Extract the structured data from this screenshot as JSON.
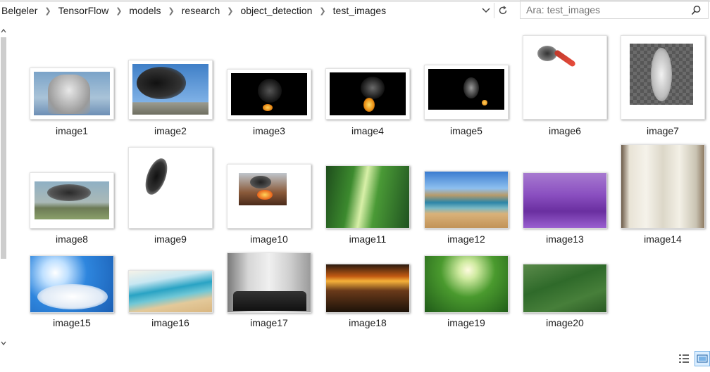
{
  "breadcrumb": [
    "Belgeler",
    "TensorFlow",
    "models",
    "research",
    "object_detection",
    "test_images"
  ],
  "search": {
    "placeholder": "Ara: test_images"
  },
  "files": [
    {
      "name": "image1",
      "icon": "smoke-stacks-image"
    },
    {
      "name": "image2",
      "icon": "black-smoke-image"
    },
    {
      "name": "image3",
      "icon": "smoke-fire-dark-image"
    },
    {
      "name": "image4",
      "icon": "smoke-fire-dark-image"
    },
    {
      "name": "image5",
      "icon": "smoke-fire-dark-image"
    },
    {
      "name": "image6",
      "icon": "smoke-red-image"
    },
    {
      "name": "image7",
      "icon": "white-smoke-image"
    },
    {
      "name": "image8",
      "icon": "smoke-landscape-image"
    },
    {
      "name": "image9",
      "icon": "black-smoke-image"
    },
    {
      "name": "image10",
      "icon": "fire-building-image"
    },
    {
      "name": "image11",
      "icon": "forest-image"
    },
    {
      "name": "image12",
      "icon": "beach-image"
    },
    {
      "name": "image13",
      "icon": "lavender-field-image"
    },
    {
      "name": "image14",
      "icon": "curtain-window-image"
    },
    {
      "name": "image15",
      "icon": "sky-clouds-image"
    },
    {
      "name": "image16",
      "icon": "beach-image"
    },
    {
      "name": "image17",
      "icon": "living-room-image"
    },
    {
      "name": "image18",
      "icon": "sunset-sea-image"
    },
    {
      "name": "image19",
      "icon": "forest-image"
    },
    {
      "name": "image20",
      "icon": "forest-hill-image"
    }
  ],
  "colors": {
    "accent": "#0078d7",
    "folder_bg": "#ffffff"
  }
}
